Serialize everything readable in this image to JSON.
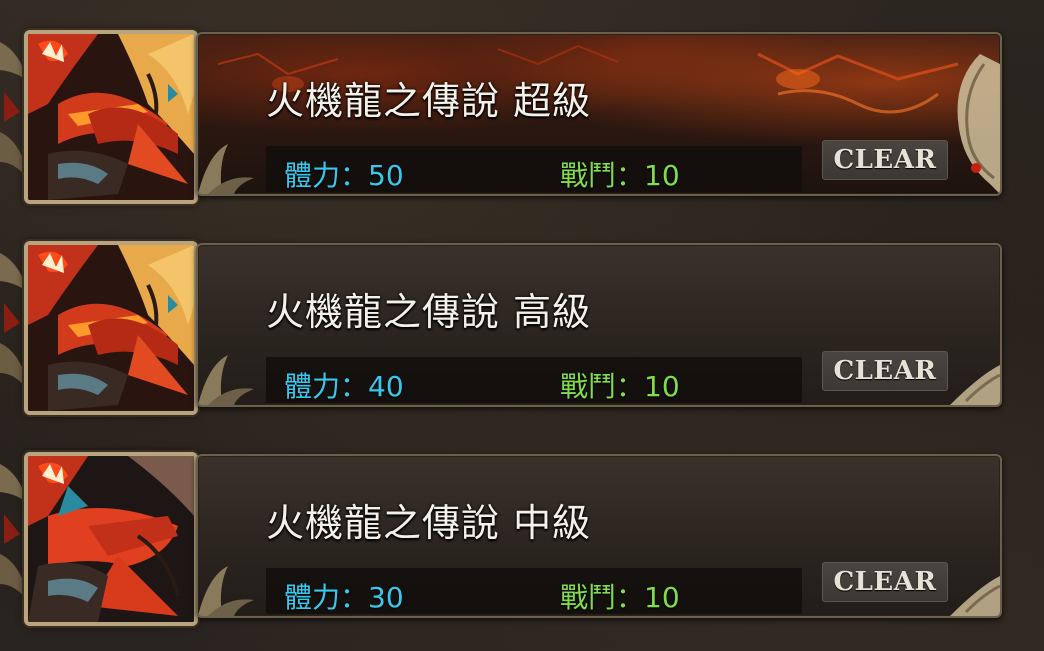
{
  "stages": [
    {
      "title": "火機龍之傳說 超級",
      "stamina": "體力：50",
      "battles": "戰鬥：10",
      "status": "CLEAR",
      "icon": "fire-dragon-icon"
    },
    {
      "title": "火機龍之傳說 高級",
      "stamina": "體力：40",
      "battles": "戰鬥：10",
      "status": "CLEAR",
      "icon": "fire-dragon-icon"
    },
    {
      "title": "火機龍之傳說 中級",
      "stamina": "體力：30",
      "battles": "戰鬥：10",
      "status": "CLEAR",
      "icon": "fire-dragon-icon"
    }
  ],
  "colors": {
    "stamina": "#38c8ee",
    "battles": "#7fdc4a",
    "title": "#f4f1ea",
    "clear_text": "#e7e2d6",
    "frame": "#b8a580"
  }
}
